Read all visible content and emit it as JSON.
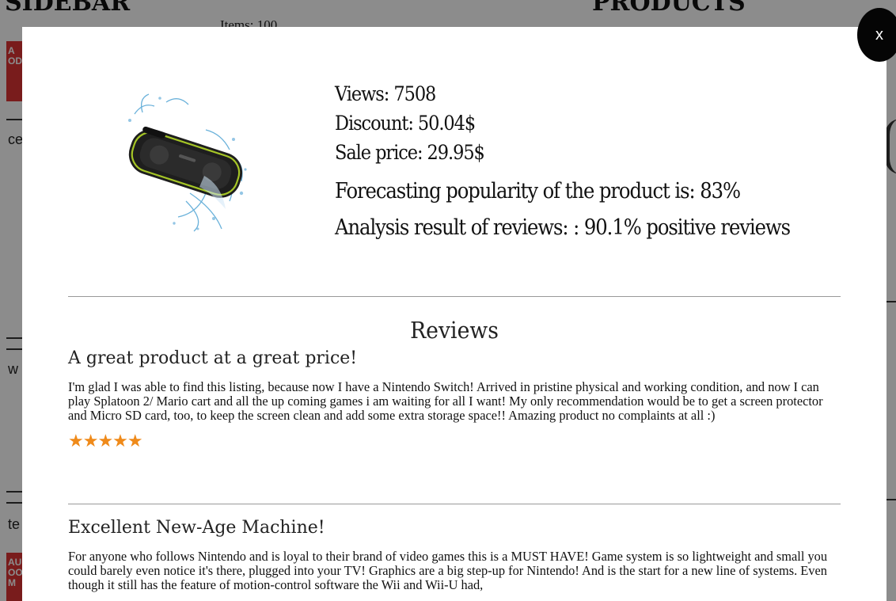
{
  "background": {
    "sidebar_title": "SIDEBAR",
    "items_count": "Items: 100",
    "products_title": "PRODUCTS",
    "red_button_top": "A\nOD",
    "red_button_bottom": "AU\nOO\nM",
    "frag_1": "ce",
    "frag_2": "w",
    "frag_3": "te"
  },
  "modal": {
    "close_label": "x",
    "product_image_icon": "bluetooth-speaker-image",
    "stats": {
      "views": "Views: 7508",
      "discount": "Discount: 50.04$",
      "sale_price": "Sale price: 29.95$",
      "forecast": "Forecasting popularity of the product is: 83%",
      "analysis": "Analysis result of reviews: : 90.1% positive reviews"
    },
    "reviews_heading": "Reviews",
    "reviews": [
      {
        "title": "A great product at a great price!",
        "body": "I'm glad I was able to find this listing, because now I have a Nintendo Switch! Arrived in pristine physical and working condition, and now I can play Splatoon 2/ Mario cart and all the up coming games i am waiting for all I want! My only recommendation would be to get a screen protector and Micro SD card, too, to keep the screen clean and add some extra storage space!! Amazing product no complaints at all :)",
        "rating": 5,
        "stars_text": "★★★★★"
      },
      {
        "title": "Excellent New-Age Machine!",
        "body": "For anyone who follows Nintendo and is loyal to their brand of video games this is a MUST HAVE! Game system is so lightweight and small you could barely even notice it's there, plugged into your TV! Graphics are a big step-up for Nintendo! And is the start for a new line of systems. Even though it still has the feature of motion-control software the Wii and Wii-U had,"
      }
    ]
  },
  "colors": {
    "star": "#ef8a1a",
    "close_button": "#050505",
    "accent_red": "#d33333"
  }
}
